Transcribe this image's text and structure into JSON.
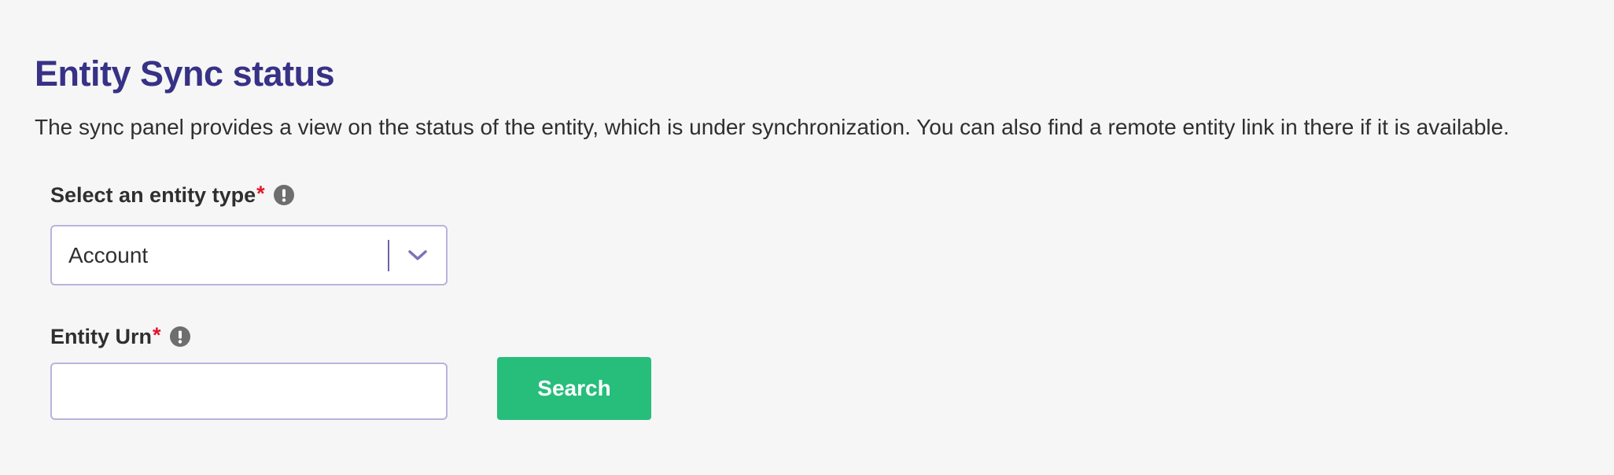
{
  "page": {
    "title": "Entity Sync status",
    "description": "The sync panel provides a view on the status of the entity, which is under synchronization. You can also find a remote entity link in there if it is available."
  },
  "form": {
    "entity_type": {
      "label": "Select an entity type",
      "required_mark": "*",
      "info_icon": "exclamation-circle-icon",
      "selected_value": "Account",
      "dropdown_icon": "chevron-down-icon"
    },
    "entity_urn": {
      "label": "Entity Urn",
      "required_mark": "*",
      "info_icon": "exclamation-circle-icon",
      "value": "",
      "placeholder": ""
    },
    "search_button": {
      "label": "Search"
    }
  },
  "colors": {
    "title": "#373286",
    "required": "#e0162b",
    "input_border": "#b9b3dc",
    "chevron": "#7b73b8",
    "button": "#27bd7b",
    "background": "#f6f6f6"
  }
}
